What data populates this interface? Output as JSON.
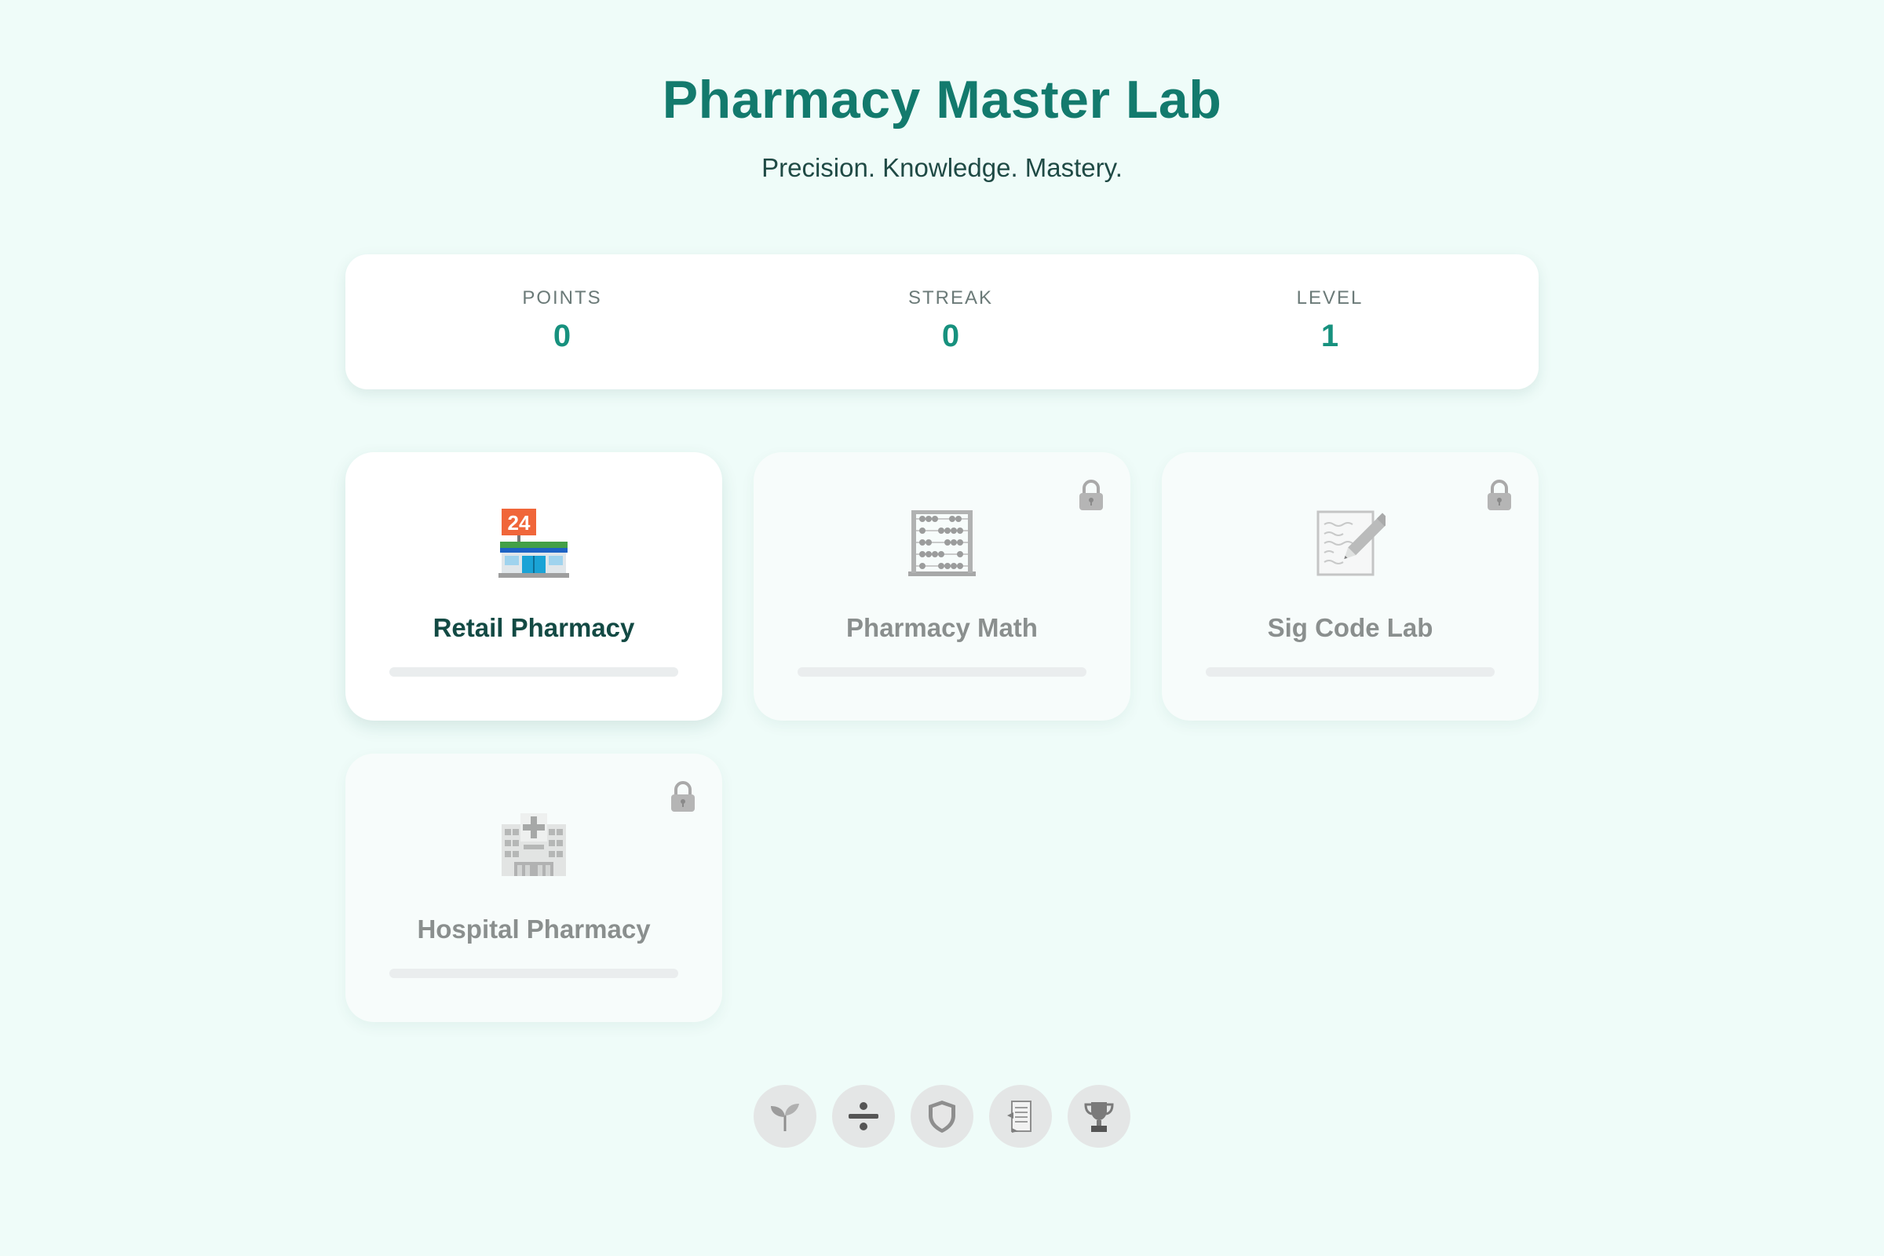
{
  "header": {
    "title": "Pharmacy Master Lab",
    "subtitle": "Precision. Knowledge. Mastery."
  },
  "stats": [
    {
      "label": "POINTS",
      "value": "0"
    },
    {
      "label": "STREAK",
      "value": "0"
    },
    {
      "label": "LEVEL",
      "value": "1"
    }
  ],
  "modules": [
    {
      "title": "Retail Pharmacy",
      "icon": "convenience-store-icon",
      "locked": false,
      "progress": 0
    },
    {
      "title": "Pharmacy Math",
      "icon": "abacus-icon",
      "locked": true,
      "progress": 0
    },
    {
      "title": "Sig Code Lab",
      "icon": "memo-icon",
      "locked": true,
      "progress": 0
    },
    {
      "title": "Hospital Pharmacy",
      "icon": "hospital-icon",
      "locked": true,
      "progress": 0
    }
  ],
  "badges": [
    "seedling-icon",
    "divide-icon",
    "shield-icon",
    "scroll-icon",
    "trophy-icon"
  ],
  "colors": {
    "background": "#effcf9",
    "title": "#137a6d",
    "accent": "#17917e",
    "locked_text": "#8a8f8e"
  }
}
